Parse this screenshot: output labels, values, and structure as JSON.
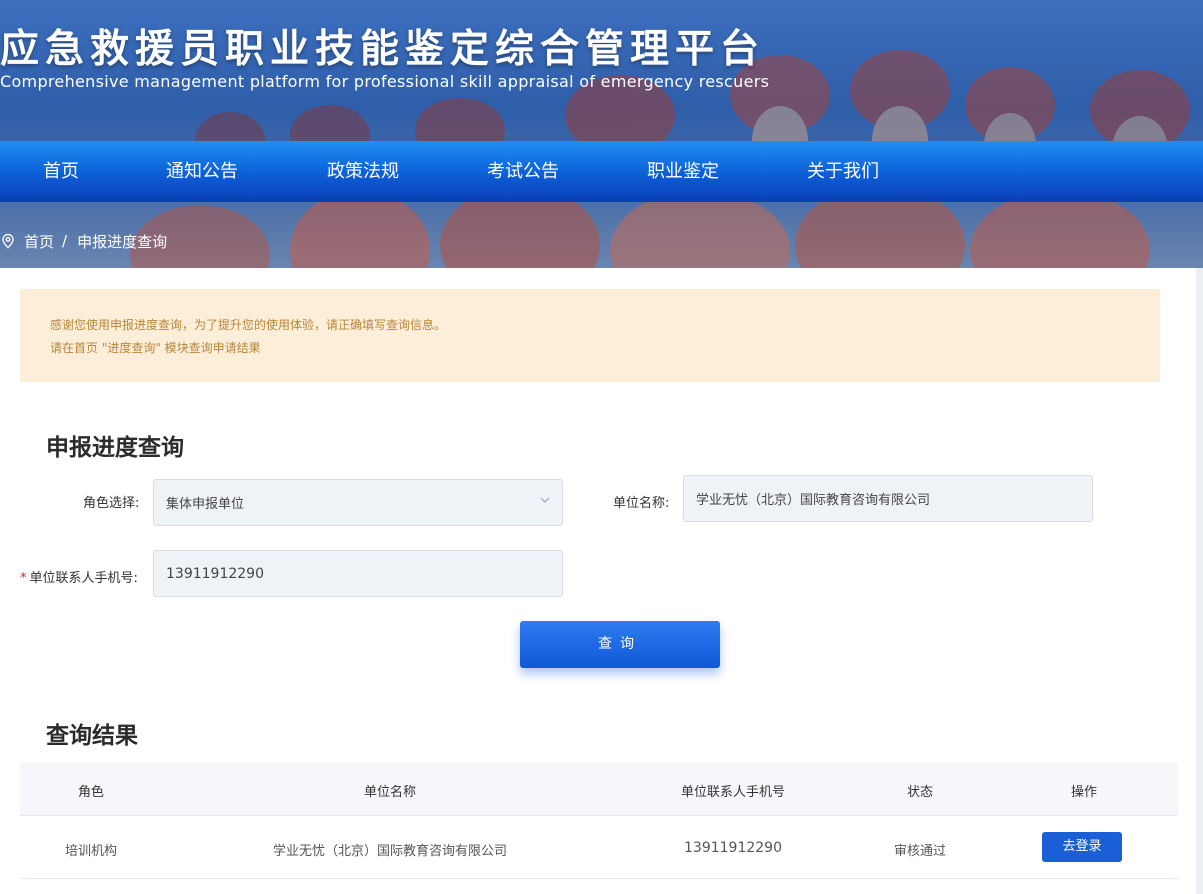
{
  "header": {
    "title": "应急救援员职业技能鉴定综合管理平台",
    "subtitle": "Comprehensive management platform for professional skill appraisal of emergency rescuers"
  },
  "nav": {
    "items": [
      {
        "label": "首页"
      },
      {
        "label": "通知公告"
      },
      {
        "label": "政策法规"
      },
      {
        "label": "考试公告"
      },
      {
        "label": "职业鉴定"
      },
      {
        "label": "关于我们"
      }
    ]
  },
  "breadcrumb": {
    "home": "首页",
    "separator": "/",
    "current": "申报进度查询"
  },
  "notice": {
    "line1": "感谢您使用申报进度查询，为了提升您的使用体验，请正确填写查询信息。",
    "line2": "请在首页 \"进度查询\" 模块查询申请结果"
  },
  "form": {
    "heading": "申报进度查询",
    "role_label": "角色选择:",
    "role_value": "集体申报单位",
    "unit_label": "单位名称:",
    "unit_value": "学业无忧（北京）国际教育咨询有限公司",
    "required_mark": "*",
    "phone_label": "单位联系人手机号:",
    "phone_value": "13911912290",
    "query_button": "查询"
  },
  "results": {
    "heading": "查询结果",
    "columns": [
      "角色",
      "单位名称",
      "单位联系人手机号",
      "状态",
      "操作"
    ],
    "rows": [
      {
        "role": "培训机构",
        "unit": "学业无忧（北京）国际教育咨询有限公司",
        "phone": "13911912290",
        "status": "审核通过",
        "action": "去登录"
      }
    ]
  },
  "colors": {
    "nav_blue": "#0d5ed8",
    "notice_bg": "#fdeed9",
    "notice_text": "#b7873a",
    "button_blue": "#1a5fd6",
    "required_red": "#e02020"
  }
}
